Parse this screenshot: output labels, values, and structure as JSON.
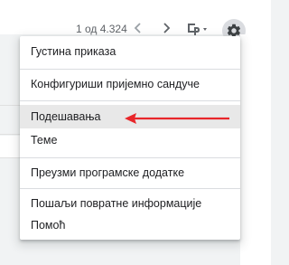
{
  "toolbar": {
    "page_count": "1 од 4.324",
    "prev_icon": "chevron-left-icon",
    "next_icon": "chevron-right-icon",
    "input_tools_icon": "input-tools-icon",
    "settings_icon": "gear-icon"
  },
  "menu": {
    "items": [
      {
        "label": "Густина приказа"
      },
      {
        "label": "Конфигуриши пријемно сандуче"
      },
      {
        "label": "Подешавања",
        "highlighted": true
      },
      {
        "label": "Теме"
      },
      {
        "label": "Преузми програмске додатке"
      },
      {
        "label": "Пошаљи повратне информације"
      },
      {
        "label": "Помоћ"
      }
    ]
  },
  "annotation": {
    "arrow_color": "#e8262a",
    "arrow_target": "Подешавања"
  },
  "colors": {
    "highlight_bg": "#e8e8e8",
    "settings_button_bg": "#dadce0",
    "icon": "#5f6368"
  }
}
